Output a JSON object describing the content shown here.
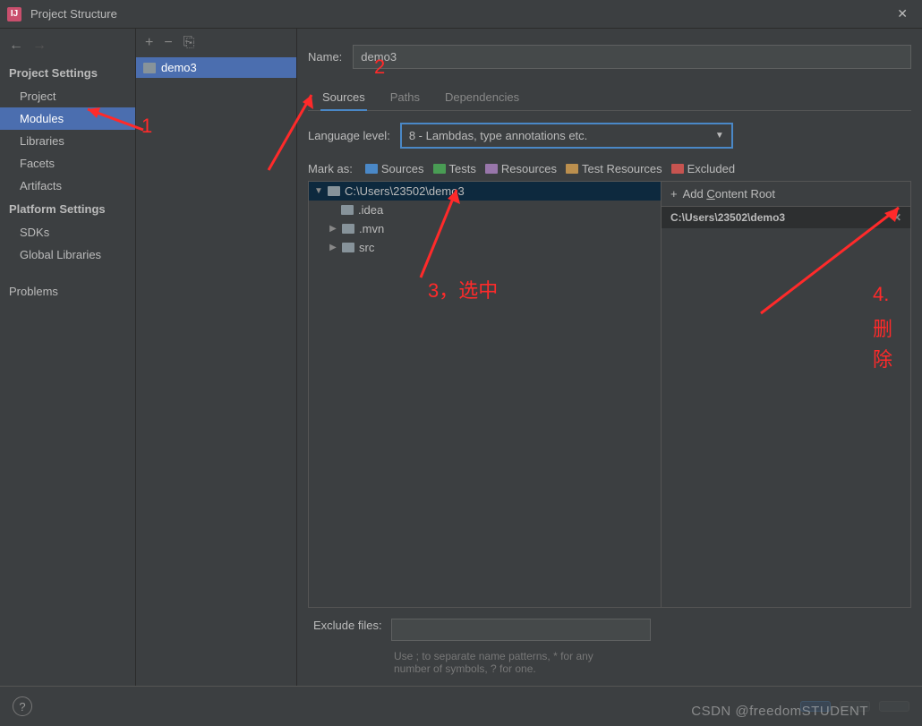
{
  "title": "Project Structure",
  "sidebar": {
    "section1": "Project Settings",
    "items1": [
      "Project",
      "Modules",
      "Libraries",
      "Facets",
      "Artifacts"
    ],
    "section2": "Platform Settings",
    "items2": [
      "SDKs",
      "Global Libraries"
    ],
    "section3_item": "Problems"
  },
  "module": {
    "name": "demo3"
  },
  "form": {
    "name_label": "Name:",
    "name_value": "demo3",
    "tabs": [
      "Sources",
      "Paths",
      "Dependencies"
    ],
    "lang_label": "Language level:",
    "lang_value": "8 - Lambdas, type annotations etc.",
    "mark_label": "Mark as:",
    "mark_sources": "Sources",
    "mark_tests": "Tests",
    "mark_resources": "Resources",
    "mark_testres": "Test Resources",
    "mark_excluded": "Excluded"
  },
  "tree": {
    "root": "C:\\Users\\23502\\demo3",
    "children": [
      ".idea",
      ".mvn",
      "src"
    ]
  },
  "right": {
    "add_label": "Add Content Root",
    "content_root": "C:\\Users\\23502\\demo3"
  },
  "exclude": {
    "label": "Exclude files:",
    "hint": "Use ; to separate name patterns, * for any number of symbols, ? for one."
  },
  "annotations": {
    "a1": "1",
    "a2": "2",
    "a3": "3，选中",
    "a4_line1": "4.",
    "a4_line2": "删",
    "a4_line3": "除"
  },
  "watermark": "CSDN @freedomSTUDENT",
  "underline_c": "C"
}
